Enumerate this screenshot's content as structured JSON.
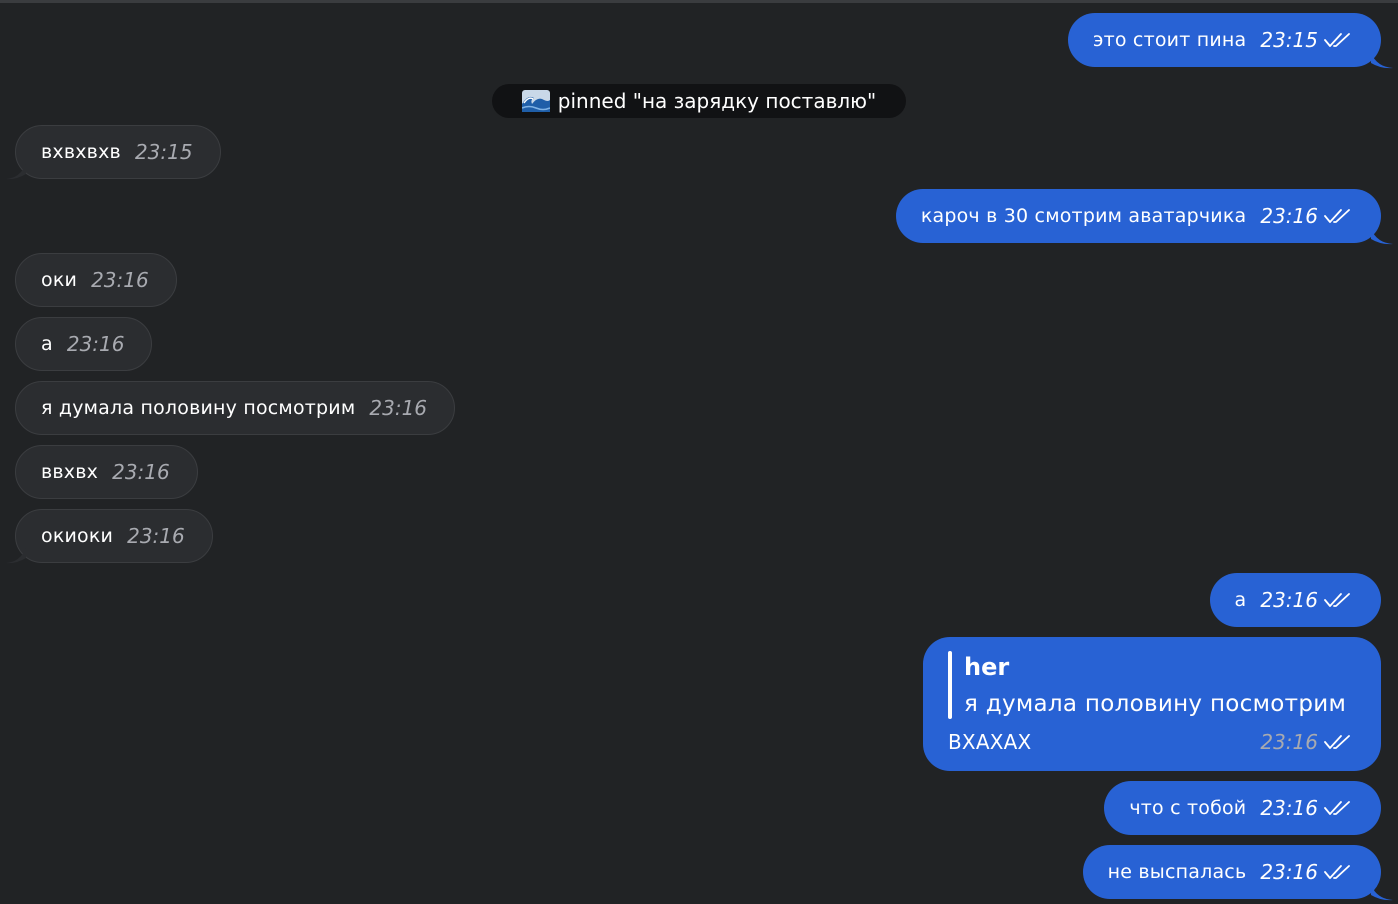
{
  "colors": {
    "background": "#212325",
    "incoming_bubble": "#2b2d30",
    "outgoing_bubble": "#2862d4",
    "pinned_pill": "#111214"
  },
  "icons": {
    "read_receipt": "double-check-icon",
    "pin_emoji": "water-wave-emoji-icon"
  },
  "pinned": {
    "text": "pinned \"на зарядку поставлю\""
  },
  "messages": [
    {
      "direction": "out",
      "text": "это стоит пина",
      "time": "23:15"
    },
    {
      "direction": "in",
      "text": "вхвхвхв",
      "time": "23:15"
    },
    {
      "direction": "out",
      "text": "кароч в 30 смотрим аватарчика",
      "time": "23:16"
    },
    {
      "direction": "in",
      "text": "оки",
      "time": "23:16"
    },
    {
      "direction": "in",
      "text": "а",
      "time": "23:16"
    },
    {
      "direction": "in",
      "text": "я думала половину посмотрим",
      "time": "23:16"
    },
    {
      "direction": "in",
      "text": "ввхвх",
      "time": "23:16"
    },
    {
      "direction": "in",
      "text": "окиоки",
      "time": "23:16"
    },
    {
      "direction": "out",
      "text": "а",
      "time": "23:16"
    },
    {
      "direction": "out",
      "text": "ВХАХАХ",
      "time": "23:16",
      "reply_to": {
        "name": "her",
        "text": "я думала половину посмотрим"
      }
    },
    {
      "direction": "out",
      "text": "что с тобой",
      "time": "23:16"
    },
    {
      "direction": "out",
      "text": "не выспалась",
      "time": "23:16"
    }
  ]
}
